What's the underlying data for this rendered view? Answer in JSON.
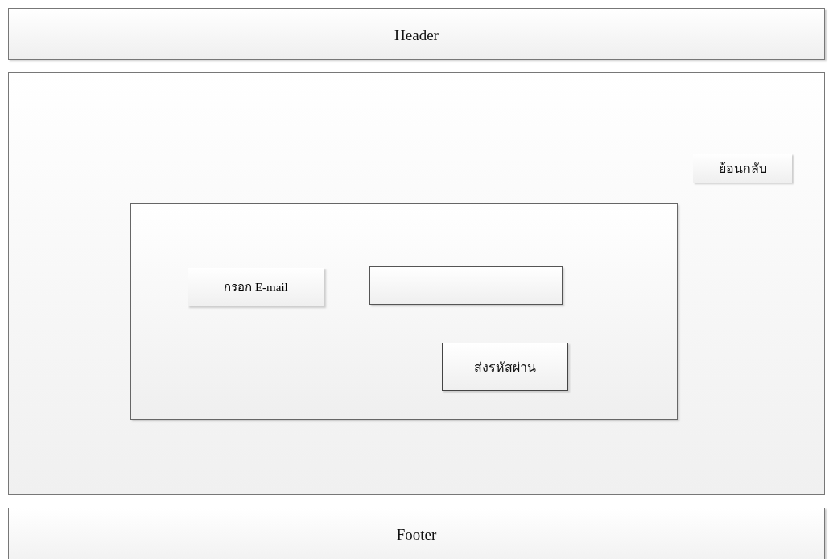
{
  "header": {
    "title": "Header"
  },
  "back_button": {
    "label": "ย้อนกลับ"
  },
  "form": {
    "email_label": "กรอก E-mail",
    "submit_button": "ส่งรหัสผ่าน"
  },
  "footer": {
    "title": "Footer"
  }
}
